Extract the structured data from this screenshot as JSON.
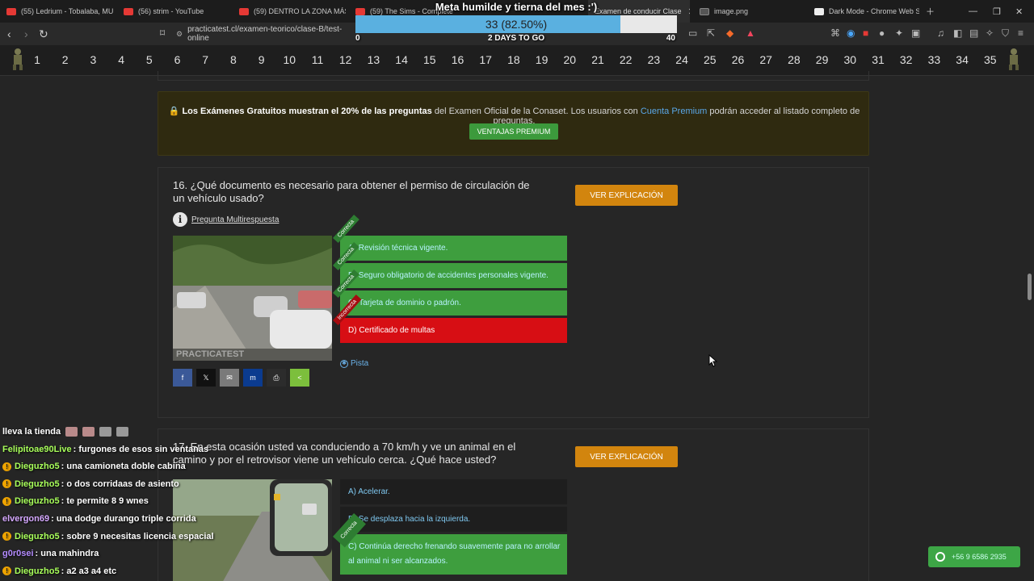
{
  "tabs": [
    {
      "title": "(55) Ledrium - Tobalaba, MUT",
      "icon": "youtube-icon"
    },
    {
      "title": "(56) strim - YouTube",
      "icon": "youtube-icon"
    },
    {
      "title": "(59) DENTRO LA ZONA MÁS TI",
      "icon": "youtube-icon"
    },
    {
      "title": "(59) The Sims - Complete",
      "icon": "youtube-icon"
    },
    {
      "title": "Examen de conducir Clase",
      "icon": "document-icon"
    },
    {
      "title": "image.png",
      "icon": "document-icon"
    },
    {
      "title": "Dark Mode - Chrome Web Sto",
      "icon": "chrome-web-store-icon"
    }
  ],
  "address": {
    "url": "practicatest.cl/examen-teorico/clase-B/test-online"
  },
  "goal": {
    "title": "Meta humilde y tierna del mes :')",
    "percent_text": "33 (82.50%)",
    "progress": 0.825,
    "min": "0",
    "max": "40",
    "days": "2 DAYS TO GO"
  },
  "question_numbers": [
    "1",
    "2",
    "3",
    "4",
    "5",
    "6",
    "7",
    "8",
    "9",
    "10",
    "11",
    "12",
    "13",
    "14",
    "15",
    "16",
    "17",
    "18",
    "19",
    "20",
    "21",
    "22",
    "23",
    "24",
    "25",
    "26",
    "27",
    "28",
    "29",
    "30",
    "31",
    "32",
    "33",
    "34",
    "35"
  ],
  "banner": {
    "bold_text": "Los Exámenes Gratuitos muestran el 20% de las preguntas",
    "text_mid": " del Examen Oficial de la Conaset. Los usuarios con ",
    "link_text": "Cuenta Premium",
    "text_end": " podrán acceder al listado completo de preguntas.",
    "button": "VENTAJAS PREMIUM"
  },
  "q16": {
    "title": "16. ¿Qué documento es necesario para obtener el permiso de circulación de un vehículo usado?",
    "explain_button": "VER EXPLICACIÓN",
    "multi_label": "Pregunta Multirespuesta",
    "photo_watermark": "PRACTICATEST",
    "answers": [
      {
        "text": "A) Revisión técnica vigente.",
        "status": "Correcta"
      },
      {
        "text": "B) Seguro obligatorio de accidentes personales vigente.",
        "status": "Correcta"
      },
      {
        "text": "C) Tarjeta de dominio o padrón.",
        "status": "Correcta"
      },
      {
        "text": "D) Certificado de multas",
        "status": "Incorrecta"
      }
    ],
    "hint": "Pista",
    "share": [
      "f",
      "𝕏",
      "✉",
      "m",
      "⎙",
      "<"
    ]
  },
  "q17": {
    "title": "17. En esta ocasión usted va conduciendo a 70 km/h y ve un animal en el camino y por el retrovisor viene un vehículo cerca. ¿Qué hace usted?",
    "explain_button": "VER EXPLICACIÓN",
    "answers": [
      {
        "text": "A) Acelerar.",
        "status": ""
      },
      {
        "text": "B) Se desplaza hacia la izquierda.",
        "status": ""
      },
      {
        "text": "C) Continúa derecho frenando suavemente para no arrollar al animal ni ser alcanzados.",
        "status": "Correcta"
      }
    ]
  },
  "chat": [
    {
      "nick": "",
      "text": "lleva la tienda",
      "color": "#ffffff",
      "badge": false,
      "emotes": true
    },
    {
      "nick": "Felipitoae90Live",
      "text": ": furgones de esos sin ventanas",
      "color": "#a8ff5a",
      "badge": false
    },
    {
      "nick": "Dieguzho5",
      "text": ": una camioneta doble cabina",
      "color": "#a8ff5a",
      "badge": true
    },
    {
      "nick": "Dieguzho5",
      "text": ": o dos corridaas de asiento",
      "color": "#a8ff5a",
      "badge": true
    },
    {
      "nick": "Dieguzho5",
      "text": ": te permite 8 9 wnes",
      "color": "#a8ff5a",
      "badge": true
    },
    {
      "nick": "elvergon69",
      "text": ": una dodge durango triple corrida",
      "color": "#d5a8ff",
      "badge": false
    },
    {
      "nick": "Dieguzho5",
      "text": ": sobre 9 necesitas licencia espacial",
      "color": "#a8ff5a",
      "badge": true
    },
    {
      "nick": "g0r0sei",
      "text": ": una mahindra",
      "color": "#b48cff",
      "badge": false
    },
    {
      "nick": "Dieguzho5",
      "text": ": a2 a3 a4 etc",
      "color": "#a8ff5a",
      "badge": true
    }
  ],
  "whatsapp": {
    "number": "+56 9 6586 2935"
  },
  "colors": {
    "correct": "#3e9e3e",
    "incorrect": "#d70e14",
    "accent": "#d2850e",
    "goal_fill": "#5ab0e0"
  }
}
